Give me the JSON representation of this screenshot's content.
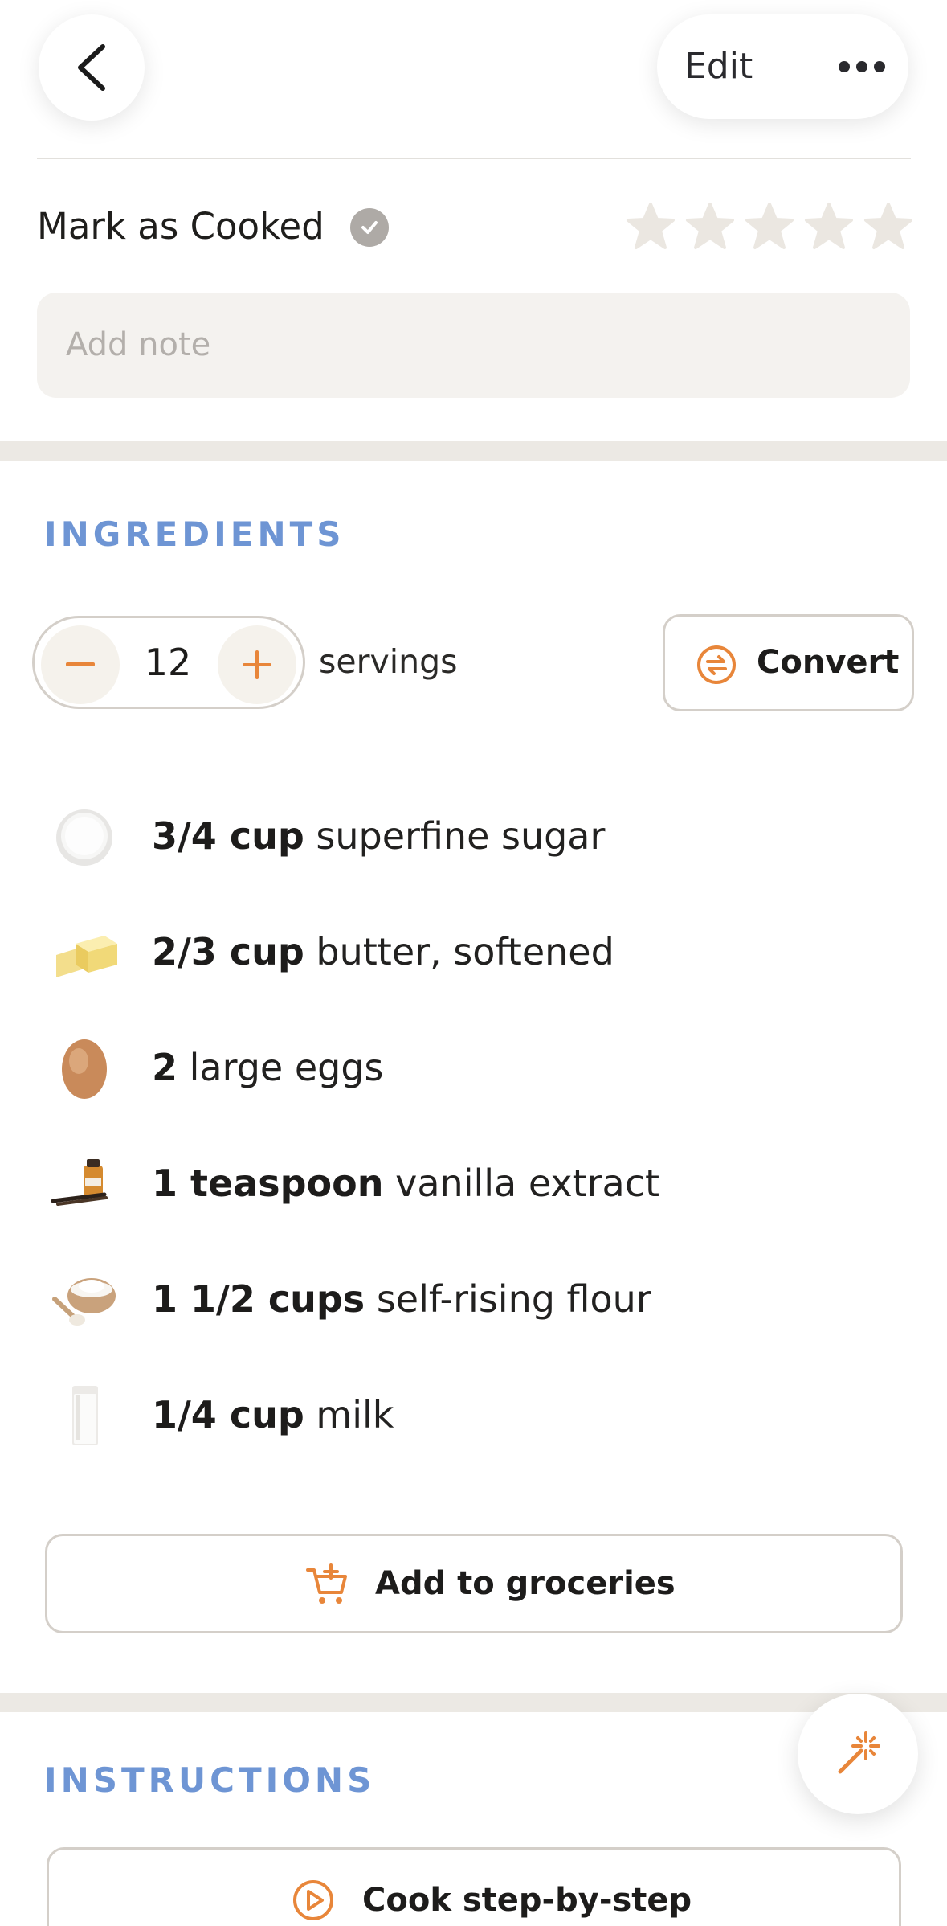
{
  "header": {
    "edit_label": "Edit"
  },
  "cooked": {
    "label": "Mark as Cooked",
    "rating": 0,
    "rating_max": 5
  },
  "note": {
    "placeholder": "Add note"
  },
  "ingredients": {
    "title": "INGREDIENTS",
    "servings_count": "12",
    "servings_label": "servings",
    "convert_label": "Convert",
    "items": [
      {
        "qty": "3/4 cup",
        "name": "superfine sugar",
        "icon": "sugar-bowl"
      },
      {
        "qty": "2/3 cup",
        "name": "butter, softened",
        "icon": "butter"
      },
      {
        "qty": "2",
        "name": "large eggs",
        "icon": "egg"
      },
      {
        "qty": "1 teaspoon",
        "name": "vanilla extract",
        "icon": "vanilla"
      },
      {
        "qty": "1 1/2 cups",
        "name": "self-rising flour",
        "icon": "flour"
      },
      {
        "qty": "1/4 cup",
        "name": "milk",
        "icon": "milk-glass"
      }
    ],
    "add_groceries_label": "Add to groceries"
  },
  "instructions": {
    "title": "INSTRUCTIONS",
    "cook_label": "Cook step-by-step"
  },
  "colors": {
    "accent_orange": "#e8863a",
    "section_blue": "#6e95d4",
    "band": "#ece9e4"
  }
}
